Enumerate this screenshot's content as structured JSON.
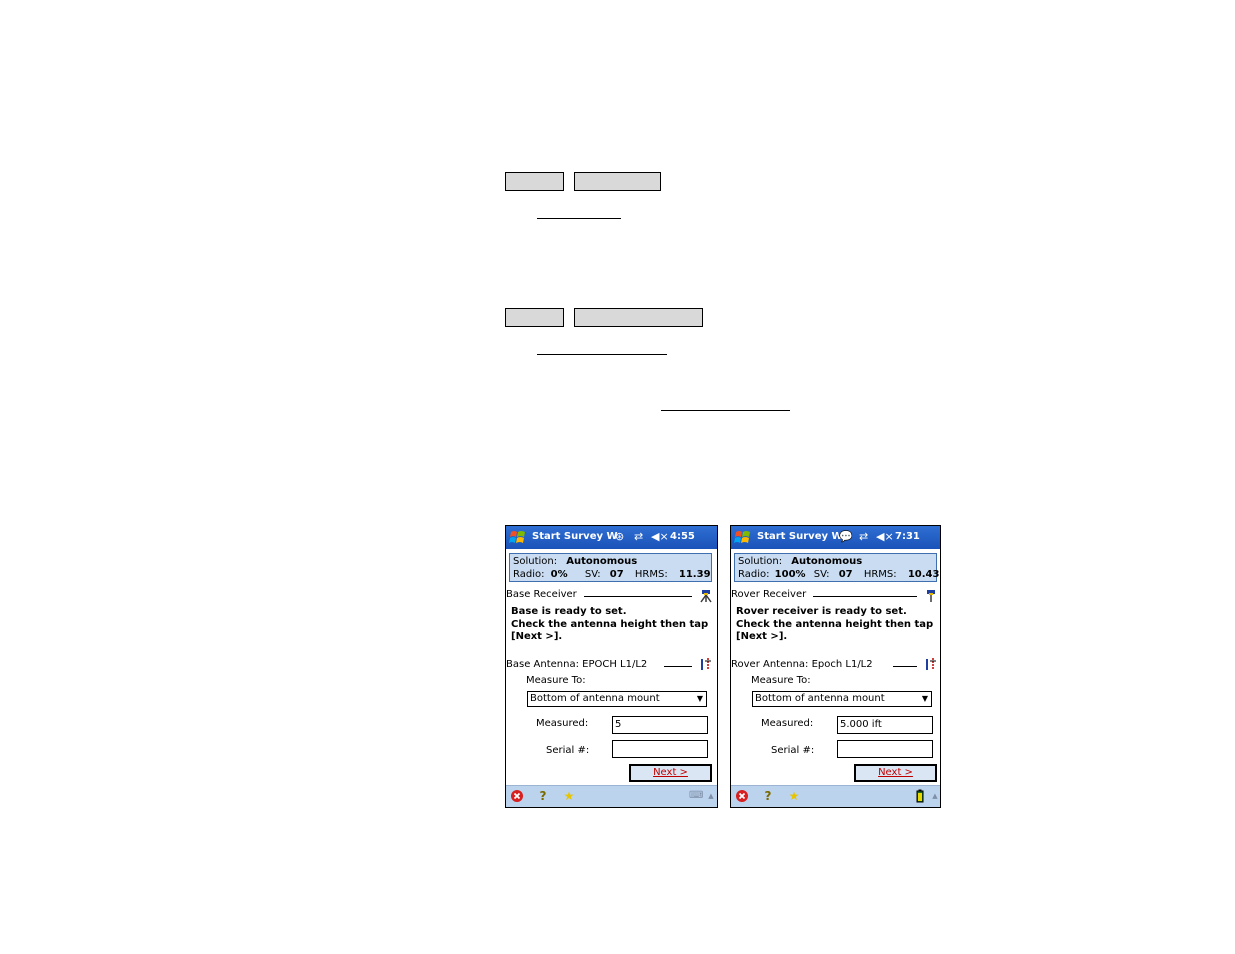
{
  "colors": {
    "title_bar": "#1a52b8",
    "status_panel": "#c9dcf2",
    "next_text": "#c00000",
    "bottom_bar": "#bcd3ee"
  },
  "screens": [
    {
      "title": "Start Survey W",
      "time": "4:55",
      "status": {
        "solution_label": "Solution:",
        "solution_value": "Autonomous",
        "radio_label": "Radio:",
        "radio_value": "0%",
        "sv_label": "SV:",
        "sv_value": "07",
        "hrms_label": "HRMS:",
        "hrms_value": "11.39"
      },
      "receiver_heading": "Base Receiver",
      "message": [
        "Base is ready to set.",
        "Check the antenna height then tap",
        "[Next >]."
      ],
      "antenna_heading": "Base Antenna: EPOCH L1/L2",
      "measure_to_label": "Measure To:",
      "measure_to_value": "Bottom of antenna mount",
      "measured_label": "Measured:",
      "measured_value": "5",
      "serial_label": "Serial #:",
      "serial_value": "",
      "next_label": "Next >",
      "bottom_icons": [
        "close-icon",
        "help-icon",
        "favorites-icon",
        "keyboard-icon"
      ]
    },
    {
      "title": "Start Survey W",
      "time": "7:31",
      "status": {
        "solution_label": "Solution:",
        "solution_value": "Autonomous",
        "radio_label": "Radio:",
        "radio_value": "100%",
        "sv_label": "SV:",
        "sv_value": "07",
        "hrms_label": "HRMS:",
        "hrms_value": "10.43"
      },
      "receiver_heading": "Rover Receiver",
      "message": [
        "Rover receiver is ready to set.",
        "Check the antenna height then tap",
        "[Next >]."
      ],
      "antenna_heading": "Rover Antenna: Epoch L1/L2",
      "measure_to_label": "Measure To:",
      "measure_to_value": "Bottom of antenna mount",
      "measured_label": "Measured:",
      "measured_value": "5.000 ift",
      "serial_label": "Serial #:",
      "serial_value": "",
      "next_label": "Next >",
      "bottom_icons": [
        "close-icon",
        "help-icon",
        "favorites-icon",
        "battery-icon"
      ]
    }
  ]
}
